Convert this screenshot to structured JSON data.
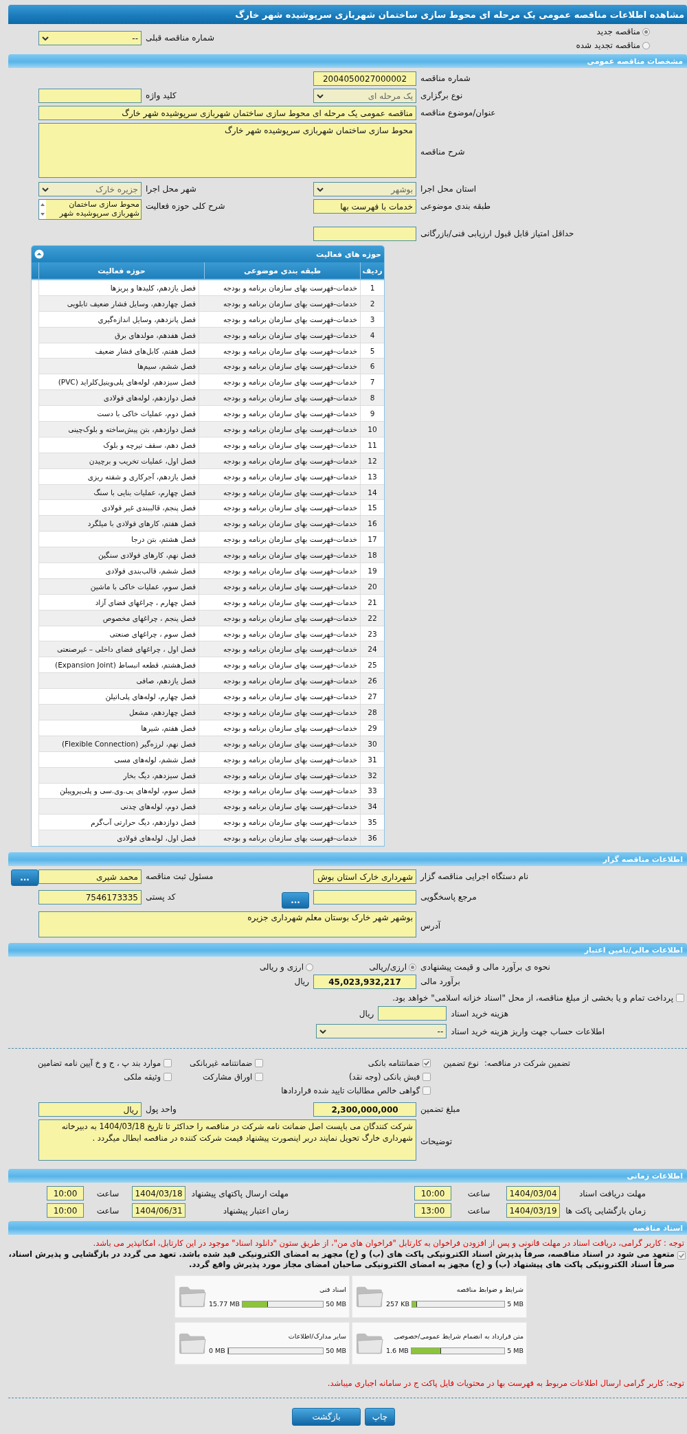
{
  "page_title": "مشاهده اطلاعات مناقصه عمومی یک مرحله ای محوط سازی ساختمان شهربازی سرپوشیده شهر خارگ",
  "tender_kind": [
    {
      "label": "مناقصه جدید",
      "selected": true
    },
    {
      "label": "مناقصه تجدید شده",
      "selected": false
    }
  ],
  "previous_tender": {
    "label": "شماره مناقصه قبلی",
    "value": "--"
  },
  "general": {
    "header": "مشخصات مناقصه عمومی",
    "tender_number": {
      "label": "شماره مناقصه",
      "value": "2004050027000002"
    },
    "holding_type": {
      "label": "نوع برگزاری",
      "value": "یک مرحله ای"
    },
    "keyword": {
      "label": "کلید واژه"
    },
    "title": {
      "label": "عنوان/موضوع مناقصه",
      "value": "مناقصه عمومی یک مرحله ای محوط سازی ساختمان شهربازی سرپوشیده شهر خارگ"
    },
    "description": {
      "label": "شرح مناقصه",
      "value": "محوط سازی ساختمان شهربازی سرپوشیده شهر خارگ"
    },
    "province": {
      "label": "استان محل اجرا",
      "value": "بوشهر"
    },
    "city": {
      "label": "شهر محل اجرا",
      "value": "جزیره خارک"
    },
    "category": {
      "label": "طبقه بندی موضوعی",
      "value": "خدمات با فهرست بها"
    },
    "activity_summary": {
      "label": "شرح کلی حوزه فعالیت",
      "value": "محوط سازی ساختمان شهربازی سرپوشیده شهر"
    },
    "min_score": {
      "label": "حداقل امتیاز قابل قبول ارزیابی فنی/بازرگانی"
    }
  },
  "activities": {
    "title": "حوزه های فعالیت",
    "columns": [
      "ردیف",
      "طبقه بندی موضوعی",
      "حوزه فعالیت"
    ],
    "rows": [
      {
        "number": "1",
        "category": "خدمات-فهرست بهای سازمان برنامه و بودجه",
        "activity": "فصل یازدهم، کلیدها و پریزها"
      },
      {
        "number": "2",
        "category": "خدمات-فهرست بهای سازمان برنامه و بودجه",
        "activity": "فصل چهاردهم، وسایل فشار ضعیف تابلویی"
      },
      {
        "number": "3",
        "category": "خدمات-فهرست بهای سازمان برنامه و بودجه",
        "activity": "فصل پانزدهم، وسایل اندازه‌گیری"
      },
      {
        "number": "4",
        "category": "خدمات-فهرست بهای سازمان برنامه و بودجه",
        "activity": "فصل هفدهم، مولدهای برق"
      },
      {
        "number": "5",
        "category": "خدمات-فهرست بهای سازمان برنامه و بودجه",
        "activity": "فصل هفتم، کابل‌های فشار ضعیف"
      },
      {
        "number": "6",
        "category": "خدمات-فهرست بهای سازمان برنامه و بودجه",
        "activity": "فصل ششم، سیم‌ها"
      },
      {
        "number": "7",
        "category": "خدمات-فهرست بهای سازمان برنامه و بودجه",
        "activity": "فصل سیزدهم، لوله‌های پلی‌وینیل‌کلراید (PVC)"
      },
      {
        "number": "8",
        "category": "خدمات-فهرست بهای سازمان برنامه و بودجه",
        "activity": "فصل دوازدهم، لوله‌های فولادی"
      },
      {
        "number": "9",
        "category": "خدمات-فهرست بهای سازمان برنامه و بودجه",
        "activity": "فصل دوم، عملیات خاکی با دست"
      },
      {
        "number": "10",
        "category": "خدمات-فهرست بهای سازمان برنامه و بودجه",
        "activity": "فصل دوازدهم، بتن پیش‌ساخته و بلوک‌چینی"
      },
      {
        "number": "11",
        "category": "خدمات-فهرست بهای سازمان برنامه و بودجه",
        "activity": "فصل دهم، سقف تیرچه و بلوک"
      },
      {
        "number": "12",
        "category": "خدمات-فهرست بهای سازمان برنامه و بودجه",
        "activity": "فصل اول، عملیات تخریب و برچیدن"
      },
      {
        "number": "13",
        "category": "خدمات-فهرست بهای سازمان برنامه و بودجه",
        "activity": "فصل یازدهم، آجرکاری و شفته ریزی"
      },
      {
        "number": "14",
        "category": "خدمات-فهرست بهای سازمان برنامه و بودجه",
        "activity": "فصل چهارم، عملیات بنایی با سنگ"
      },
      {
        "number": "15",
        "category": "خدمات-فهرست بهای سازمان برنامه و بودجه",
        "activity": "فصل پنجم، قالببندی غیر فولادی"
      },
      {
        "number": "16",
        "category": "خدمات-فهرست بهای سازمان برنامه و بودجه",
        "activity": "فصل هفتم، کارهای فولادی با میلگرد"
      },
      {
        "number": "17",
        "category": "خدمات-فهرست بهای سازمان برنامه و بودجه",
        "activity": "فصل هشتم، بتن درجا"
      },
      {
        "number": "18",
        "category": "خدمات-فهرست بهای سازمان برنامه و بودجه",
        "activity": "فصل نهم، کارهای فولادی سنگین"
      },
      {
        "number": "19",
        "category": "خدمات-فهرست بهای سازمان برنامه و بودجه",
        "activity": "فصل ششم، قالب‌بندی فولادی"
      },
      {
        "number": "20",
        "category": "خدمات-فهرست بهای سازمان برنامه و بودجه",
        "activity": "فصل سوم، عملیات خاکی با ماشین"
      },
      {
        "number": "21",
        "category": "خدمات-فهرست بهای سازمان برنامه و بودجه",
        "activity": "فصل چهارم ، چراغهای فضای آزاد"
      },
      {
        "number": "22",
        "category": "خدمات-فهرست بهای سازمان برنامه و بودجه",
        "activity": "فصل پنجم ، چراغهای مخصوص"
      },
      {
        "number": "23",
        "category": "خدمات-فهرست بهای سازمان برنامه و بودجه",
        "activity": "فصل سوم ، چراغهای صنعتی"
      },
      {
        "number": "24",
        "category": "خدمات-فهرست بهای سازمان برنامه و بودجه",
        "activity": "فصل اول ، چراغهای فضای داخلی – غیرصنعتی"
      },
      {
        "number": "25",
        "category": "خدمات-فهرست بهای سازمان برنامه و بودجه",
        "activity": "فصل‌هشتم، قطعه انبساط (Expansion Joint)"
      },
      {
        "number": "26",
        "category": "خدمات-فهرست بهای سازمان برنامه و بودجه",
        "activity": "فصل یازدهم، صافی"
      },
      {
        "number": "27",
        "category": "خدمات-فهرست بهای سازمان برنامه و بودجه",
        "activity": "فصل چهارم، لوله‌های پلی‌اتیلن"
      },
      {
        "number": "28",
        "category": "خدمات-فهرست بهای سازمان برنامه و بودجه",
        "activity": "فصل چهاردهم، مشعل"
      },
      {
        "number": "29",
        "category": "خدمات-فهرست بهای سازمان برنامه و بودجه",
        "activity": "فصل هفتم، شیرها"
      },
      {
        "number": "30",
        "category": "خدمات-فهرست بهای سازمان برنامه و بودجه",
        "activity": "فصل نهم، لرزه‌گیر (Flexible Connection)"
      },
      {
        "number": "31",
        "category": "خدمات-فهرست بهای سازمان برنامه و بودجه",
        "activity": "فصل ششم، لوله‌های مسی"
      },
      {
        "number": "32",
        "category": "خدمات-فهرست بهای سازمان برنامه و بودجه",
        "activity": "فصل سیزدهم، دیگ بخار"
      },
      {
        "number": "33",
        "category": "خدمات-فهرست بهای سازمان برنامه و بودجه",
        "activity": "فصل سوم، لوله‌های پی.وی.سی و پلی‌پروپیلن"
      },
      {
        "number": "34",
        "category": "خدمات-فهرست بهای سازمان برنامه و بودجه",
        "activity": "فصل دوم، لوله‌های چدنی"
      },
      {
        "number": "35",
        "category": "خدمات-فهرست بهای سازمان برنامه و بودجه",
        "activity": "فصل دوازدهم، دیگ حرارتی آب‌گرم"
      },
      {
        "number": "36",
        "category": "خدمات-فهرست بهای سازمان برنامه و بودجه",
        "activity": "فصل اول، لوله‌های فولادی"
      }
    ]
  },
  "organizer": {
    "header": "اطلاعات مناقصه گزار",
    "executor": {
      "label": "نام دستگاه اجرایی مناقصه گزار",
      "value": "شهرداری خارک استان بوش"
    },
    "registrar": {
      "label": "مسئول ثبت مناقصه",
      "value": "محمد شیری",
      "button": "..."
    },
    "responder": {
      "label": "مرجع پاسخگویی",
      "button": "..."
    },
    "postal_code": {
      "label": "کد پستی",
      "value": "7546173335"
    },
    "address": {
      "label": "آدرس",
      "value": "بوشهر   شهر خارک بوستان معلم شهرداری جزیره"
    }
  },
  "finance": {
    "header": "اطلاعات مالی/تامین اعتبار",
    "estimate_method": {
      "label": "نحوه ی برآورد مالی و قیمت پیشنهادی",
      "options": [
        {
          "label": "ارزی/ریالی",
          "selected": true
        },
        {
          "label": "ارزی و ریالی",
          "selected": false
        }
      ]
    },
    "budget": {
      "label": "برآورد مالی",
      "value": "45,023,932,217",
      "unit": "ریال"
    },
    "treasury": {
      "label": "پرداخت تمام و یا بخشی از مبلغ مناقصه، از محل \"اسناد خزانه اسلامی\" خواهد بود.",
      "checked": false
    },
    "document_cost": {
      "label": "هزینه خرید اسناد",
      "unit": "ریال"
    },
    "account": {
      "label": "اطلاعات حساب جهت واریز هزینه خرید اسناد",
      "value": "--"
    },
    "guarantee": {
      "label": "تضمین شرکت در مناقصه:",
      "type_label": "نوع تضمین",
      "options": [
        {
          "label": "ضمانتنامه بانکی",
          "checked": true
        },
        {
          "label": "ضمانتنامه غیربانکی",
          "checked": false
        },
        {
          "label": "موارد بند پ ، ج و خ آیین نامه تضامین",
          "checked": false
        },
        {
          "label": "فیش بانکی (وجه نقد)",
          "checked": false
        },
        {
          "label": "اوراق مشارکت",
          "checked": false
        },
        {
          "label": "وثیقه ملکی",
          "checked": false
        },
        {
          "label": "گواهی خالص مطالبات تایید شده قراردادها",
          "checked": false
        }
      ]
    },
    "amount": {
      "label": "مبلغ تضمین",
      "value": "2,300,000,000"
    },
    "currency": {
      "label": "واحد پول",
      "value": "ریال"
    },
    "notes": {
      "label": "توضیحات",
      "value": "شرکت کنندگان می بایست اصل ضمانت نامه شرکت در مناقصه را حداکثر تا تاریخ 1404/03/18 به دبیرخانه شهرداری خارگ تحویل نمایند دربر اینصورت پیشنهاد قیمت شرکت کننده در مناقصه ابطال میگردد ."
    }
  },
  "schedule": {
    "header": "اطلاعات زمانی",
    "items": [
      {
        "label": "مهلت دریافت اسناد",
        "date": "1404/03/04",
        "time_label": "ساعت",
        "time": "10:00"
      },
      {
        "label": "مهلت ارسال پاکتهای پیشنهاد",
        "date": "1404/03/18",
        "time_label": "ساعت",
        "time": "10:00"
      },
      {
        "label": "زمان بازگشایی پاکت ها",
        "date": "1404/03/19",
        "time_label": "ساعت",
        "time": "13:00"
      },
      {
        "label": "زمان اعتبار پیشنهاد",
        "date": "1404/06/31",
        "time_label": "ساعت",
        "time": "10:00"
      }
    ]
  },
  "documents": {
    "header": "اسناد مناقصه",
    "notice": "توجه : کاربر گرامی، دریافت اسناد در مهلت قانونی و پس از افزودن فراخوان به کارتابل \"فراخوان های من\"، از طریق ستون \"دانلود اسناد\" موجود در این کارتابل، امکانپذیر می باشد.",
    "commitment": {
      "checked": true,
      "text": "متعهد می شود در اسناد مناقصه، صرفاً پذیرش اسناد الکترونیکی پاکت های (ب) و (ج) مجهز به امضای الکترونیکی قید شده باشد. تعهد می گردد در بازگشایی و پذیرش اسناد، صرفاً اسناد الکترونیکی پاکت های پیشنهاد (ب) و (ج) مجهز به امضای الکترونیکی صاحبان امضای مجاز مورد پذیرش واقع گردد."
    },
    "files": [
      {
        "title": "شرایط و ضوابط مناقصه",
        "used": "257 KB",
        "limit": "5 MB",
        "level": 0.05
      },
      {
        "title": "اسناد فنی",
        "used": "15.77 MB",
        "limit": "50 MB",
        "level": 0.32
      },
      {
        "title": "متن قرارداد به انضمام شرایط عمومی/خصوصی",
        "used": "1.6 MB",
        "limit": "5 MB",
        "level": 0.32
      },
      {
        "title": "سایر مدارک/اطلاعات",
        "used": "0 MB",
        "limit": "50 MB",
        "level": 0
      }
    ],
    "footnote": "توجه: کاربر گرامی ارسال اطلاعات مربوط به فهرست بها در محتویات فایل پاکت ج در سامانه اجباری میباشد."
  },
  "buttons": [
    "چاپ",
    "بازگشت"
  ]
}
